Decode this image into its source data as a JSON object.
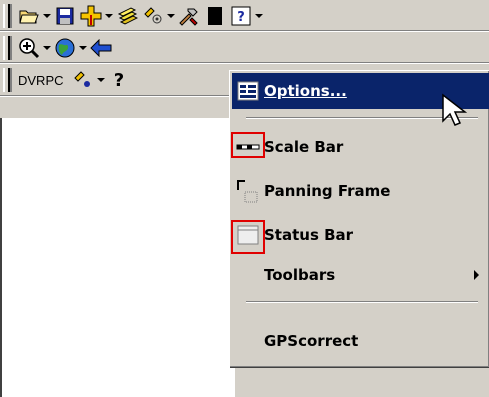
{
  "toolbars": {
    "standard": {
      "buttons": [
        {
          "name": "open-icon"
        },
        {
          "name": "save-icon"
        },
        {
          "name": "add-data-icon"
        },
        {
          "name": "layers-icon"
        },
        {
          "name": "gps-icon"
        },
        {
          "name": "tools-icon"
        },
        {
          "name": "black-square-icon"
        },
        {
          "name": "help-icon"
        }
      ]
    },
    "navigation": {
      "buttons": [
        {
          "name": "zoom-in-icon"
        },
        {
          "name": "globe-icon"
        },
        {
          "name": "back-arrow-icon"
        }
      ]
    },
    "dvrpc": {
      "label": "DVRPC",
      "buttons": [
        {
          "name": "gps-icon"
        },
        {
          "name": "help-query-icon"
        }
      ]
    }
  },
  "menu": {
    "items": [
      {
        "label": "Options...",
        "icon": "options-icon",
        "selected": true
      },
      {
        "label": "Scale Bar",
        "icon": "scale-bar-icon"
      },
      {
        "label": "Panning Frame",
        "icon": "panning-frame-icon"
      },
      {
        "label": "Status Bar",
        "icon": "status-bar-icon"
      },
      {
        "label": "Toolbars",
        "icon": "",
        "submenu": true
      },
      {
        "label": "GPScorrect",
        "icon": ""
      }
    ]
  },
  "colors": {
    "face": "#d4d0c8",
    "selection": "#0a246a",
    "highlight_box": "#e00000"
  }
}
